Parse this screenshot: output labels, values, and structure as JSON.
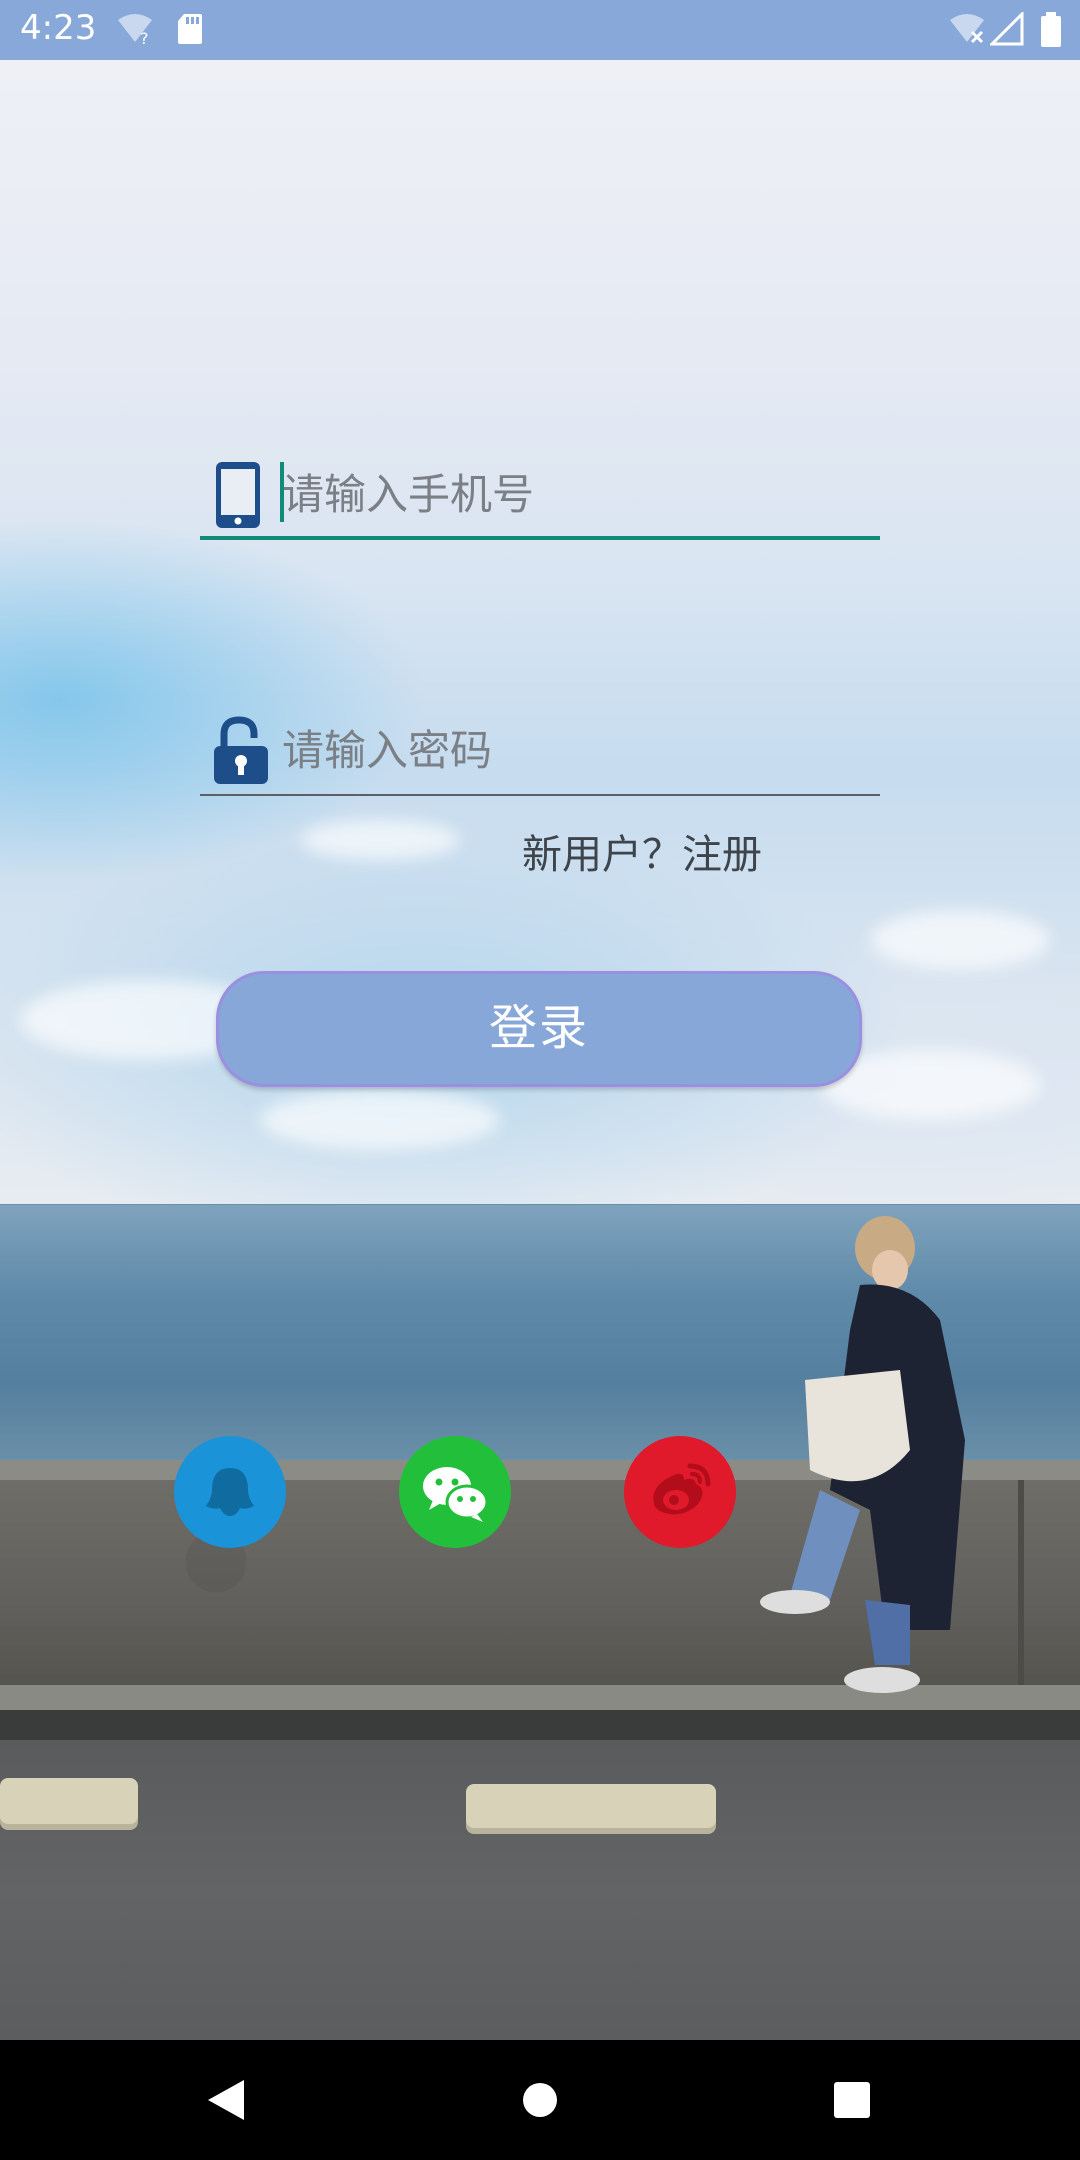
{
  "status_bar": {
    "time": "4:23",
    "icons": [
      "wifi-unknown-icon",
      "sd-card-icon",
      "wifi-off-icon",
      "cell-signal-icon",
      "battery-icon"
    ]
  },
  "login_form": {
    "phone": {
      "placeholder": "请输入手机号",
      "value": "",
      "icon": "phone-icon"
    },
    "password": {
      "placeholder": "请输入密码",
      "value": "",
      "icon": "unlock-icon"
    },
    "register_link": "新用户？注册",
    "login_button": "登录",
    "accent_color": "#128a78",
    "button_color": "#87a7d8"
  },
  "social_login": [
    {
      "name": "QQ",
      "icon": "qq-icon",
      "color": "#1a93d8"
    },
    {
      "name": "WeChat",
      "icon": "wechat-icon",
      "color": "#22c03a"
    },
    {
      "name": "Weibo",
      "icon": "weibo-icon",
      "color": "#e0192b"
    }
  ],
  "nav_bar": {
    "buttons": [
      "back-icon",
      "home-icon",
      "recents-icon"
    ]
  }
}
